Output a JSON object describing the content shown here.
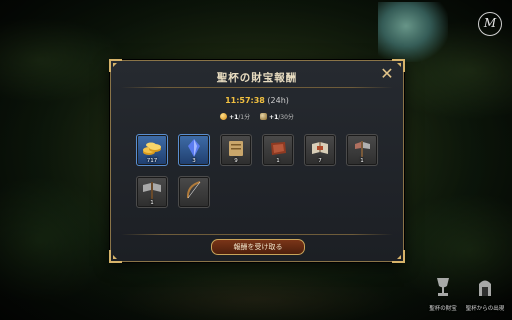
{
  "dialog": {
    "title": "聖杯の財宝報酬",
    "timer_value": "11:57:38",
    "timer_suffix": "(24h)",
    "rates": [
      {
        "icon": "gold-coin-icon",
        "value": "+1",
        "unit": "/1分"
      },
      {
        "icon": "chest-icon",
        "value": "+1",
        "unit": "/30分"
      }
    ],
    "close_icon": "close-icon",
    "claim_label": "報酬を受け取る"
  },
  "rewards": [
    {
      "icon": "gold-coins-icon",
      "count": "717",
      "rarity": "rare"
    },
    {
      "icon": "blue-crystal-icon",
      "count": "3",
      "rarity": "rare"
    },
    {
      "icon": "scroll-icon",
      "count": "9",
      "rarity": "common"
    },
    {
      "icon": "leather-icon",
      "count": "1",
      "rarity": "common"
    },
    {
      "icon": "book-icon",
      "count": "7",
      "rarity": "common"
    },
    {
      "icon": "axe-icon",
      "count": "1",
      "rarity": "common"
    },
    {
      "icon": "battle-axe-icon",
      "count": "1",
      "rarity": "common"
    },
    {
      "icon": "bow-icon",
      "count": "",
      "rarity": "common"
    }
  ],
  "bottom_menu": [
    {
      "label": "聖杯の財宝",
      "icon": "grail-icon"
    },
    {
      "label": "聖杯からの出現",
      "icon": "shrine-icon"
    }
  ],
  "top_emblem_icon": "guild-emblem-icon",
  "colors": {
    "accent_gold": "#f1c040",
    "frame": "#8a7448",
    "claim_button": "#7a3518"
  }
}
